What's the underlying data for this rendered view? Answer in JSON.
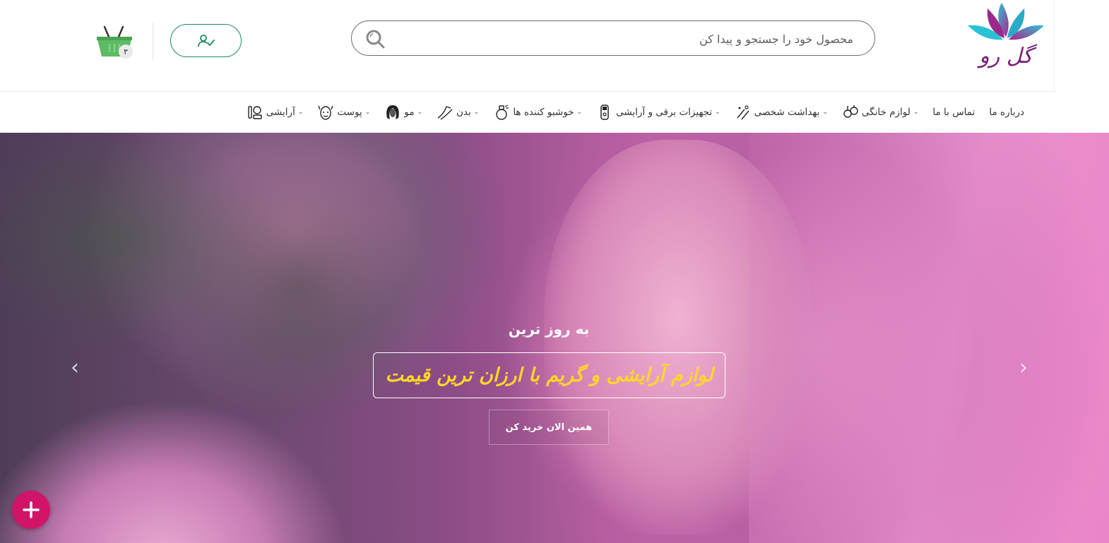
{
  "header": {
    "logo_text": "گل رو",
    "search": {
      "placeholder": "محصول خود را جستجو و پیدا کن",
      "value": ""
    },
    "account_button": {
      "icon": "user-check-icon"
    },
    "cart": {
      "icon": "shopping-basket-icon",
      "count": "۳"
    },
    "colors": {
      "brand": "#7a1e78",
      "accent": "#1c8a62",
      "cart_green": "#5dbb63"
    }
  },
  "nav": {
    "items": [
      {
        "label": "آرایشی",
        "icon": "makeup-icon",
        "has_dropdown": true
      },
      {
        "label": "پوست",
        "icon": "face-care-icon",
        "has_dropdown": true
      },
      {
        "label": "مو",
        "icon": "hair-icon",
        "has_dropdown": true
      },
      {
        "label": "بدن",
        "icon": "body-icon",
        "has_dropdown": true
      },
      {
        "label": "خوشبو کننده ها",
        "icon": "perfume-icon",
        "has_dropdown": true
      },
      {
        "label": "تجهیزات برقی و آرایشی",
        "icon": "shaver-icon",
        "has_dropdown": true
      },
      {
        "label": "بهداشت شخصی",
        "icon": "hygiene-icon",
        "has_dropdown": true
      },
      {
        "label": "لوازم خانگی",
        "icon": "home-appliance-icon",
        "has_dropdown": true
      },
      {
        "label": "تماس با ما",
        "icon": "",
        "has_dropdown": false
      },
      {
        "label": "درباره ما",
        "icon": "",
        "has_dropdown": false
      }
    ]
  },
  "hero": {
    "subtitle": "به روز ترین",
    "title": "لوازم آرایشی و گریم با ارزان ترین قیمت",
    "cta": "همین الان خرید کن",
    "prev_icon": "chevron-left-icon",
    "next_icon": "chevron-right-icon",
    "colors": {
      "title": "#ffd52a"
    }
  },
  "fab": {
    "icon": "plus-icon",
    "color": "#d21468"
  }
}
